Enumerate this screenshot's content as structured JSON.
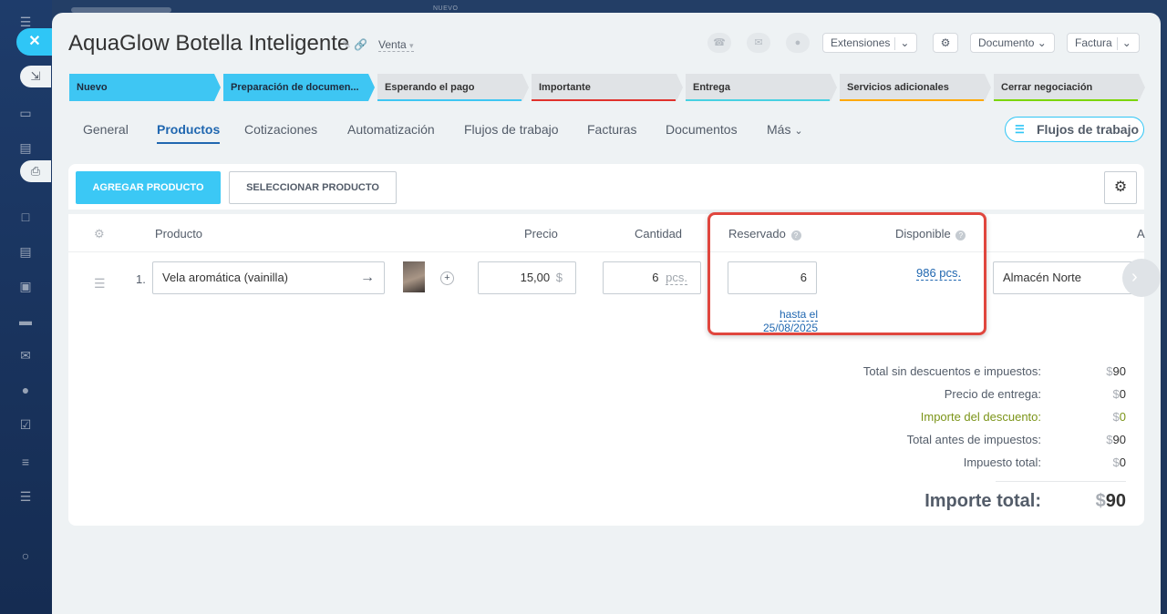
{
  "window": {
    "top_hint": "NUEVO"
  },
  "header": {
    "title": "AquaGlow Botella Inteligente",
    "category": "Venta",
    "extensions_label": "Extensiones",
    "document_label": "Documento",
    "invoice_label": "Factura"
  },
  "stages": [
    {
      "label": "Nuevo",
      "state": "active",
      "color": "#3ec6f3"
    },
    {
      "label": "Preparación de documen...",
      "state": "active",
      "color": "#3ec6f3"
    },
    {
      "label": "Esperando el pago",
      "state": "todo",
      "color": "#3ec6f3"
    },
    {
      "label": "Importante",
      "state": "todo",
      "color": "#e0322c"
    },
    {
      "label": "Entrega",
      "state": "todo",
      "color": "#47d1e2"
    },
    {
      "label": "Servicios adicionales",
      "state": "todo",
      "color": "#ffa900"
    },
    {
      "label": "Cerrar negociación",
      "state": "todo",
      "color": "#7bd500"
    }
  ],
  "tabs": [
    {
      "label": "General",
      "active": false
    },
    {
      "label": "Productos",
      "active": true
    },
    {
      "label": "Cotizaciones",
      "active": false
    },
    {
      "label": "Automatización",
      "active": false
    },
    {
      "label": "Flujos de trabajo",
      "active": false
    },
    {
      "label": "Facturas",
      "active": false
    },
    {
      "label": "Documentos",
      "active": false
    },
    {
      "label": "Más",
      "active": false
    }
  ],
  "flows_button": "Flujos de trabajo",
  "toolbar": {
    "add_product": "AGREGAR PRODUCTO",
    "select_product": "SELECCIONAR PRODUCTO"
  },
  "table": {
    "headers": {
      "product": "Producto",
      "price": "Precio",
      "quantity": "Cantidad",
      "reserved": "Reservado",
      "available": "Disponible",
      "extra": "A"
    },
    "row": {
      "number": "1.",
      "product": "Vela aromática (vainilla)",
      "price": "15,00",
      "currency": "$",
      "quantity": "6",
      "unit": "pcs.",
      "reserved": "6",
      "reserved_until_prefix": "hasta el",
      "reserved_until_date": "25/08/2025",
      "available": "986 pcs.",
      "warehouse": "Almacén Norte"
    }
  },
  "totals": {
    "without_discount_label": "Total sin descuentos e impuestos:",
    "without_discount_value": "90",
    "delivery_label": "Precio de entrega:",
    "delivery_value": "0",
    "discount_label": "Importe del descuento:",
    "discount_value": "0",
    "before_tax_label": "Total antes de impuestos:",
    "before_tax_value": "90",
    "tax_label": "Impuesto total:",
    "tax_value": "0",
    "grand_label": "Importe total:",
    "grand_value": "90",
    "currency_symbol": "$"
  },
  "colors": {
    "accent": "#2fc6f6",
    "link": "#2067b0",
    "highlight_frame": "#e0463e",
    "discount": "#7b9418"
  }
}
